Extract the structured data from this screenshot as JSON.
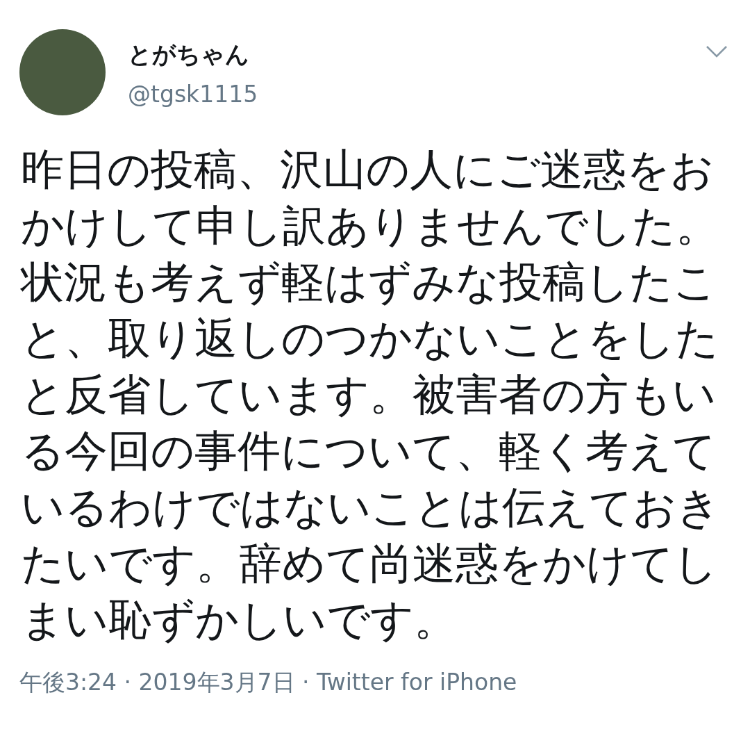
{
  "tweet": {
    "display_name": "とがちゃん",
    "handle": "@tgsk1115",
    "text": "昨日の投稿、沢山の人にご迷惑をおかけして申し訳ありませんでした。状況も考えず軽はずみな投稿したこと、取り返しのつかないことをしたと反省しています。被害者の方もいる今回の事件について、軽く考えているわけではないことは伝えておきたいです。辞めて尚迷惑をかけてしまい恥ずかしいです。",
    "meta": "午後3:24 · 2019年3月7日 · Twitter for iPhone"
  }
}
